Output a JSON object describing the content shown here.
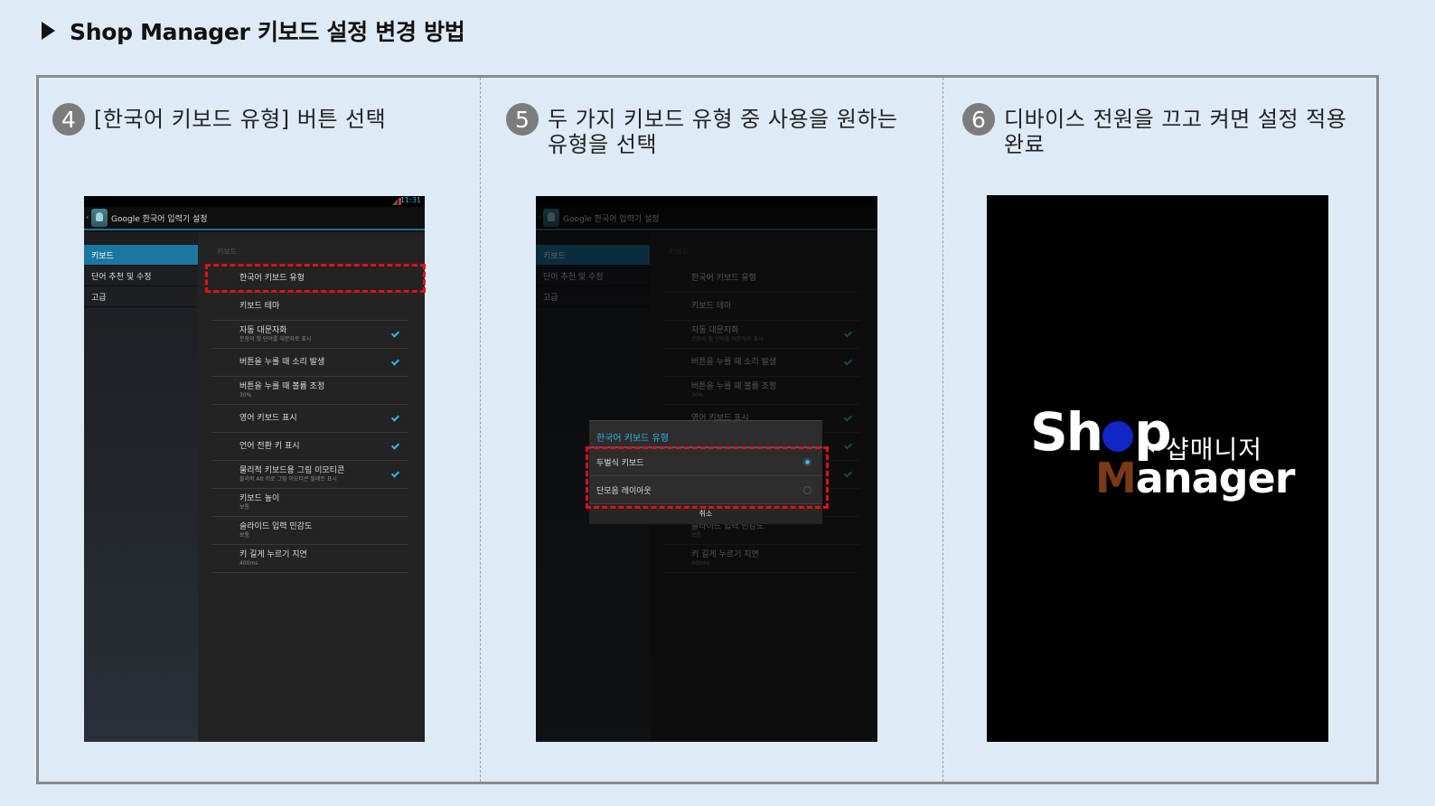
{
  "page_title": "Shop Manager 키보드 설정 변경 방법",
  "steps": [
    {
      "number": "4",
      "text": "[한국어 키보드 유형] 버튼 선택"
    },
    {
      "number": "5",
      "text_line1": "두 가지 키보드 유형 중 사용을 원하는",
      "text_line2": "유형을 선택"
    },
    {
      "number": "6",
      "text_line1": "디바이스 전원을 끄고 켜면 설정 적용",
      "text_line2": "완료"
    }
  ],
  "phone": {
    "status_time": "11:31",
    "app_title": "Google 한국어 입력기 설정",
    "back_glyph": "‹",
    "side_items": [
      "키보드",
      "단어 추천 및 수정",
      "고급"
    ],
    "category": "키보드",
    "settings": [
      {
        "label": "한국어 키보드 유형",
        "sub": "",
        "checked": false
      },
      {
        "label": "키보드 테마",
        "sub": "",
        "checked": false
      },
      {
        "label": "자동 대문자화",
        "sub": "문장의 첫 단어를 대문자로 표시",
        "checked": true
      },
      {
        "label": "버튼을 누를 때 소리 발생",
        "sub": "",
        "checked": true
      },
      {
        "label": "버튼을 누를 때 볼륨 조정",
        "sub": "30%",
        "checked": false
      },
      {
        "label": "영어 키보드 표시",
        "sub": "",
        "checked": true
      },
      {
        "label": "언어 전환 키 표시",
        "sub": "",
        "checked": true
      },
      {
        "label": "물리적 키보드용 그림 이모티콘",
        "sub": "물리적 Alt 키로 그림 이모티콘 팔레트 표시",
        "checked": true
      },
      {
        "label": "키보드 높이",
        "sub": "보통",
        "checked": false
      },
      {
        "label": "슬라이드 입력 민감도",
        "sub": "보통",
        "checked": false
      },
      {
        "label": "키 길게 누르기 지연",
        "sub": "400ms",
        "checked": false
      }
    ]
  },
  "dialog": {
    "title": "한국어 키보드 유형",
    "options": [
      {
        "label": "두벌식 키보드",
        "selected": true
      },
      {
        "label": "단모음 레이아웃",
        "selected": false
      }
    ],
    "cancel": "취소"
  },
  "logo": {
    "shop_pre": "Sh",
    "shop_post": "p",
    "korean": "샵매니저",
    "manager_first": "M",
    "manager_rest": "anager"
  },
  "colors": {
    "page_bg": "#deeaf6",
    "accent_blue": "#33b5e5",
    "highlight_red": "#e0101a",
    "logo_blue": "#1126c4",
    "logo_brown": "#7a3a16"
  }
}
